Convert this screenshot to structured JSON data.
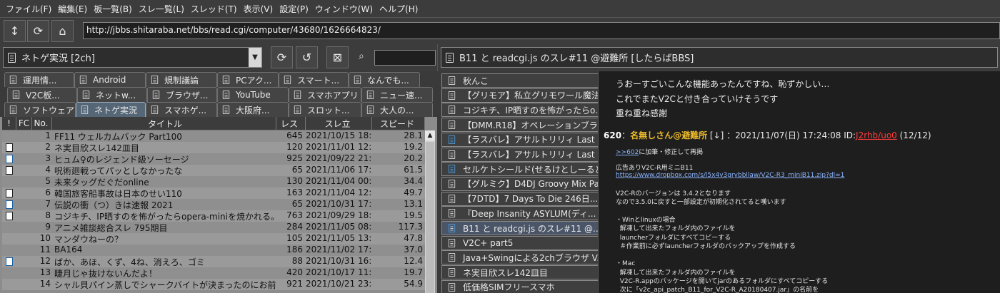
{
  "menu": [
    "ファイル(F)",
    "編集(E)",
    "板一覧(B)",
    "スレ一覧(L)",
    "スレッド(T)",
    "表示(V)",
    "設定(P)",
    "ウィンドウ(W)",
    "ヘルプ(H)"
  ],
  "toolbar": {
    "url": "http://jbbs.shitaraba.net/bbs/read.cgi/computer/43680/1626664823/"
  },
  "board": {
    "combo_value": "ネトゲ実況 [2ch]",
    "search_value": ""
  },
  "tab_rows": [
    [
      "運用情...",
      "Android",
      "規制議論",
      "PCアク...",
      "スマート...",
      "なんでも..."
    ],
    [
      "V2C板...",
      "ネットw...",
      "ブラウザ...",
      "YouTube",
      "スマホアプリ",
      "ニュー速..."
    ],
    [
      "ソフトウェア",
      "ネトゲ実況",
      "スマホゲ...",
      "大阪府...",
      "スロット...",
      "大人の..."
    ]
  ],
  "columns": [
    "!",
    "FC",
    "No.",
    "タイトル",
    "レス",
    "スレ立",
    "スピード"
  ],
  "rows": [
    {
      "no": "1",
      "title": "FF11 ウェルカムバック Part100",
      "res": "645",
      "date": "2021/10/15 18:50",
      "speed": "28.1",
      "icon": ""
    },
    {
      "no": "2",
      "title": "ネ実目欣スレ142皿目",
      "res": "120",
      "date": "2021/11/01 12:57",
      "speed": "19.2",
      "icon": "doc"
    },
    {
      "no": "3",
      "title": "ヒュム♀のレジェンド級ソーセージ",
      "res": "925",
      "date": "2021/09/22 21:01",
      "speed": "20.2",
      "icon": "blue"
    },
    {
      "no": "4",
      "title": "呪術廻戦ってパッとしなかったな",
      "res": "65",
      "date": "2021/11/06 17:19",
      "speed": "61.5",
      "icon": "doc"
    },
    {
      "no": "5",
      "title": "未来タッグだぐだonline",
      "res": "130",
      "date": "2021/11/04 00:01",
      "speed": "34.4",
      "icon": ""
    },
    {
      "no": "6",
      "title": "韓国旅客船事故は日本のせい110",
      "res": "163",
      "date": "2021/11/04 12:01",
      "speed": "49.7",
      "icon": "doc"
    },
    {
      "no": "7",
      "title": "伝説の衝（つ）きは速報 2021",
      "res": "65",
      "date": "2021/10/31 17:31",
      "speed": "13.1",
      "icon": "blue"
    },
    {
      "no": "8",
      "title": "コジキチ、IP晒すのを怖がったらopera-miniを焼かれる。22",
      "res": "763",
      "date": "2021/09/29 18:00",
      "speed": "19.5",
      "icon": "doc"
    },
    {
      "no": "9",
      "title": "アニメ雑談総合スレ 795期目",
      "res": "284",
      "date": "2021/11/05 08:35",
      "speed": "117.3",
      "icon": ""
    },
    {
      "no": "10",
      "title": "マンダウねーの？",
      "res": "105",
      "date": "2021/11/05 13:57",
      "speed": "47.8",
      "icon": ""
    },
    {
      "no": "11",
      "title": "BA164",
      "res": "186",
      "date": "2021/11/02 17:58",
      "speed": "37.0",
      "icon": ""
    },
    {
      "no": "12",
      "title": "ばか、あほ、くず、4ね、消えろ、ゴミ",
      "res": "88",
      "date": "2021/10/31 16:15",
      "speed": "12.4",
      "icon": "blue"
    },
    {
      "no": "13",
      "title": "睫月じゃ抜けないんだよ！",
      "res": "420",
      "date": "2021/10/17 11:06",
      "speed": "19.7",
      "icon": ""
    },
    {
      "no": "14",
      "title": "シャル貝パイン蒸しでシャークバイトが決まったのにお前らはFFか",
      "res": "921",
      "date": "2021/10/21 23:48",
      "speed": "54.9",
      "icon": ""
    }
  ],
  "thread": {
    "title": "B11 と readcgi.js のスレ#11 @避難所 [したらばBBS]"
  },
  "thread_list": [
    {
      "label": "秋んこ",
      "icon": "doc"
    },
    {
      "label": "【グリモア】私立グリモワール魔法学...",
      "icon": "doc"
    },
    {
      "label": "コジキチ、IP晒すのを怖がったらo...",
      "icon": "doc"
    },
    {
      "label": "【DMM.R18】オペレーションブラック...",
      "icon": "doc"
    },
    {
      "label": "【ラスバレ】アサルトリリィ Last Bull...",
      "icon": "blue"
    },
    {
      "label": "【ラスバレ】アサルトリリィ Last Bull...",
      "icon": "doc"
    },
    {
      "label": "セルケトシールド(せるけとしーるど/S...",
      "icon": "blue"
    },
    {
      "label": "【グルミク】D4DJ Groovy Mix Pa...",
      "icon": "doc"
    },
    {
      "label": "【7DTD】7 Days To Die 246日...",
      "icon": "doc"
    },
    {
      "label": "『Deep Insanity ASYLUM(ディ...",
      "icon": "doc"
    },
    {
      "label": "B11 と readcgi.js のスレ#11 @...",
      "icon": "sel"
    },
    {
      "label": "V2C+ part5",
      "icon": "doc"
    },
    {
      "label": "Java+Swingによる2chブラウザ V...",
      "icon": "doc"
    },
    {
      "label": "ネ実目欣スレ142皿目",
      "icon": "doc"
    },
    {
      "label": "低価格SIMフリースマホ",
      "icon": "doc"
    }
  ],
  "viewer": {
    "prev_lines": [
      "うおーすごいこんな機能あったんですね、恥ずかしい…",
      "これでまたV2Cと付き合っていけそうです",
      "重ね重ね感謝"
    ],
    "post_num": "620",
    "post_sep": "：",
    "post_name": "名無しさん@避難所",
    "post_arrow": "[↓]",
    "post_date": "：2021/11/07(日) 17:24:08 ID:",
    "post_id": "J2rhb/uo0",
    "post_count": "(12/12)",
    "reply_link": ">>602",
    "reply_text": "に加筆・修正して再掲",
    "ad_text": "広告ありV2C-R用ミニB11",
    "ad_link": "https://www.dropbox.com/s/l5x4v3grybbllaw/V2C-R3_miniB11.zip?dl=1",
    "body": [
      "V2C-Rのバージョンは 3.4.2となります",
      "なので3.5.0に戻すと一部設定が初期化されてると嘆います",
      "",
      "・Winとlinuxの場合",
      "  解凍して出来たフォルダ内のファイルを",
      "  launcherフォルダにすべてコピーする",
      "  ＃作業前に必ずlauncherフォルダのバックアップを作成する",
      "",
      "・Mac",
      "  解凍して出来たフォルダ内のファイルを",
      "  V2C-R.appのパッケージを開いてjarのあるフォルダにすべてコピーする",
      "  次に「v2c_api_patch_B11_for_V2C-R_A20180407.jar」の名前を"
    ]
  }
}
